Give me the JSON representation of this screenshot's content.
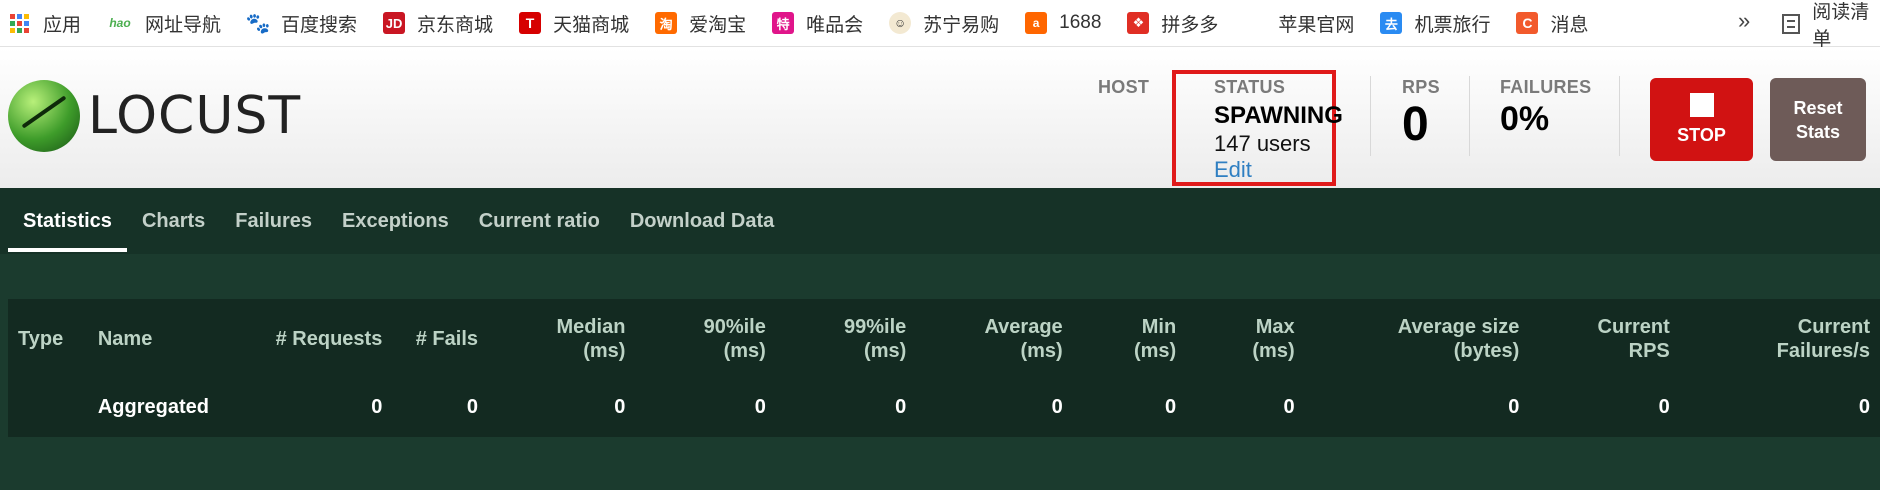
{
  "bookmarks": [
    {
      "label": "应用",
      "icon": "apps-grid-icon"
    },
    {
      "label": "网址导航",
      "icon": "hao-icon",
      "color": "#4caf50"
    },
    {
      "label": "百度搜索",
      "icon": "baidu-paw-icon",
      "color": "#2932e1"
    },
    {
      "label": "京东商城",
      "icon": "jd-icon",
      "color": "#c91623"
    },
    {
      "label": "天猫商城",
      "icon": "tmall-icon",
      "color": "#d60000"
    },
    {
      "label": "爱淘宝",
      "icon": "taobao-icon",
      "color": "#ff6a00"
    },
    {
      "label": "唯品会",
      "icon": "vip-icon",
      "color": "#e0158a"
    },
    {
      "label": "苏宁易购",
      "icon": "suning-icon",
      "color": "#f7b500"
    },
    {
      "label": "1688",
      "icon": "1688-icon",
      "color": "#ff6600"
    },
    {
      "label": "拼多多",
      "icon": "pinduoduo-icon",
      "color": "#e02e24"
    },
    {
      "label": "苹果官网",
      "icon": "apple-icon",
      "color": "#555555"
    },
    {
      "label": "机票旅行",
      "icon": "flight-icon",
      "color": "#2a8bf2"
    },
    {
      "label": "消息",
      "icon": "message-icon",
      "color": "#f25a2c"
    }
  ],
  "bookmarks_more": "»",
  "reading_list": "阅读清单",
  "header": {
    "logo_text": "LOCUST",
    "host_label": "HOST",
    "status_label": "STATUS",
    "status_value": "SPAWNING",
    "users": "147 users",
    "edit": "Edit",
    "rps_label": "RPS",
    "rps_value": "0",
    "failures_label": "FAILURES",
    "failures_value": "0%",
    "stop_label": "STOP",
    "reset_line1": "Reset",
    "reset_line2": "Stats"
  },
  "tabs": [
    "Statistics",
    "Charts",
    "Failures",
    "Exceptions",
    "Current ratio",
    "Download Data"
  ],
  "table": {
    "headers": [
      [
        "Type"
      ],
      [
        "Name"
      ],
      [
        "# Requests"
      ],
      [
        "# Fails"
      ],
      [
        "Median",
        "(ms)"
      ],
      [
        "90%ile",
        "(ms)"
      ],
      [
        "99%ile",
        "(ms)"
      ],
      [
        "Average",
        "(ms)"
      ],
      [
        "Min",
        "(ms)"
      ],
      [
        "Max",
        "(ms)"
      ],
      [
        "Average size",
        "(bytes)"
      ],
      [
        "Current",
        "RPS"
      ],
      [
        "Current",
        "Failures/s"
      ]
    ],
    "row": [
      "",
      "Aggregated",
      "0",
      "0",
      "0",
      "0",
      "0",
      "0",
      "0",
      "0",
      "0",
      "0",
      "0"
    ]
  },
  "colors": {
    "stop": "#d11212",
    "reset": "#6e5b58",
    "status_highlight": "#e01a1a",
    "main_bg": "#1b3b2e",
    "edit_link": "#2f7fc2"
  }
}
